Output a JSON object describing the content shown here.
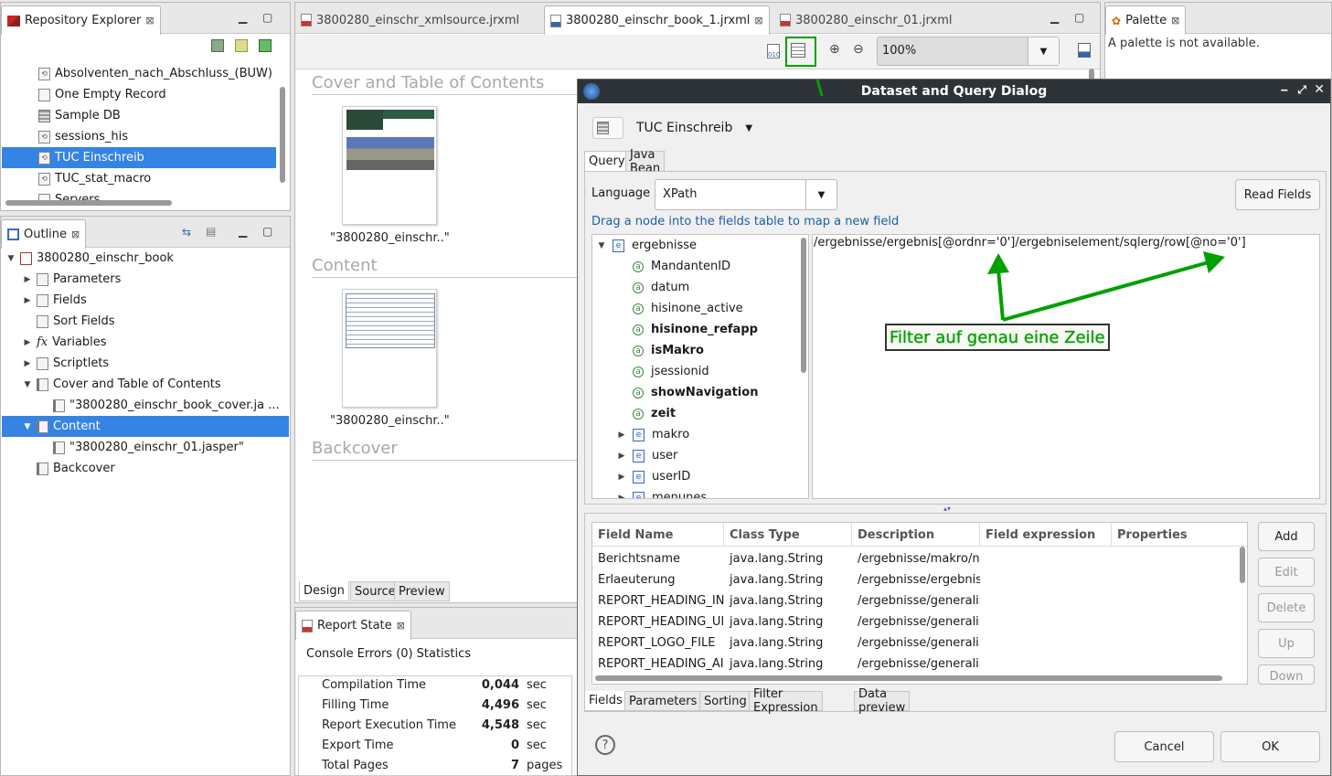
{
  "repo": {
    "tab_label": "Repository Explorer",
    "items": [
      {
        "label": "Absolventen_nach_Abschluss_(BUW)",
        "icon": "datasource-icon"
      },
      {
        "label": "One Empty Record",
        "icon": "empty-record-icon"
      },
      {
        "label": "Sample DB",
        "icon": "database-icon"
      },
      {
        "label": "sessions_his",
        "icon": "datasource-icon"
      },
      {
        "label": "TUC Einschreib",
        "icon": "datasource-icon",
        "selected": true
      },
      {
        "label": "TUC_stat_macro",
        "icon": "datasource-icon"
      },
      {
        "label": "Servers",
        "icon": "folder-icon"
      }
    ]
  },
  "outline": {
    "tab_label": "Outline",
    "items": [
      {
        "label": "3800280_einschr_book",
        "level": 0,
        "twisty": "open"
      },
      {
        "label": "Parameters",
        "level": 1,
        "twisty": "closed"
      },
      {
        "label": "Fields",
        "level": 1,
        "twisty": "closed"
      },
      {
        "label": "Sort Fields",
        "level": 1,
        "twisty": ""
      },
      {
        "label": "Variables",
        "level": 1,
        "twisty": "closed",
        "prefix": "fx"
      },
      {
        "label": "Scriptlets",
        "level": 1,
        "twisty": "closed"
      },
      {
        "label": "Cover and Table of Contents",
        "level": 1,
        "twisty": "open"
      },
      {
        "label": "\"3800280_einschr_book_cover.ja ...",
        "level": 2,
        "twisty": ""
      },
      {
        "label": "Content",
        "level": 1,
        "twisty": "open",
        "selected": true
      },
      {
        "label": "\"3800280_einschr_01.jasper\"",
        "level": 2,
        "twisty": ""
      },
      {
        "label": "Backcover",
        "level": 1,
        "twisty": ""
      }
    ]
  },
  "editor": {
    "tabs": [
      {
        "label": "3800280_einschr_xmlsource.jrxml",
        "active": false
      },
      {
        "label": "3800280_einschr_book_1.jrxml",
        "active": true
      },
      {
        "label": "3800280_einschr_01.jrxml",
        "active": false
      }
    ],
    "zoom": "100%",
    "sections": [
      {
        "title": "Cover and Table of Contents",
        "thumb_label": "\"3800280_einschr..\""
      },
      {
        "title": "Content",
        "thumb_label": "\"3800280_einschr..\""
      },
      {
        "title": "Backcover"
      }
    ],
    "bottom_tabs": [
      "Design",
      "Source",
      "Preview"
    ]
  },
  "palette": {
    "tab_label": "Palette",
    "message": "A palette is not available."
  },
  "report_state": {
    "tab_label": "Report State",
    "subtabs": [
      "Console",
      "Errors (0)",
      "Statistics"
    ],
    "rows": [
      {
        "label": "Compilation Time",
        "value": "0,044",
        "unit": "sec"
      },
      {
        "label": "Filling Time",
        "value": "4,496",
        "unit": "sec"
      },
      {
        "label": "Report Execution Time",
        "value": "4,548",
        "unit": "sec"
      },
      {
        "label": "Export Time",
        "value": "0",
        "unit": "sec"
      },
      {
        "label": "Total Pages",
        "value": "7",
        "unit": "pages"
      }
    ]
  },
  "dialog": {
    "title": "Dataset and Query Dialog",
    "datasource": "TUC Einschreib",
    "tabs": [
      "Query",
      "Java Bean"
    ],
    "language_label": "Language",
    "language_value": "XPath",
    "read_fields": "Read Fields",
    "hint": "Drag a node into the fields table to map a new field",
    "tree": [
      {
        "label": "ergebnisse",
        "kind": "element",
        "twisty": "open",
        "level": 0
      },
      {
        "label": "MandantenID",
        "kind": "attr",
        "level": 1
      },
      {
        "label": "datum",
        "kind": "attr",
        "level": 1
      },
      {
        "label": "hisinone_active",
        "kind": "attr",
        "level": 1
      },
      {
        "label": "hisinone_refapp",
        "kind": "attr",
        "level": 1,
        "bold": true
      },
      {
        "label": "isMakro",
        "kind": "attr",
        "level": 1,
        "bold": true
      },
      {
        "label": "jsessionid",
        "kind": "attr",
        "level": 1
      },
      {
        "label": "showNavigation",
        "kind": "attr",
        "level": 1,
        "bold": true
      },
      {
        "label": "zeit",
        "kind": "attr",
        "level": 1,
        "bold": true
      },
      {
        "label": "makro",
        "kind": "element",
        "twisty": "closed",
        "level": 1
      },
      {
        "label": "user",
        "kind": "element",
        "twisty": "closed",
        "level": 1
      },
      {
        "label": "userID",
        "kind": "element",
        "twisty": "closed",
        "level": 1
      },
      {
        "label": "menunes",
        "kind": "element",
        "twisty": "closed",
        "level": 1
      }
    ],
    "query": "/ergebnisse/ergebnis[@ordnr='0']/ergebniselement/sqlerg/row[@no='0']",
    "annotation": "Filter auf genau eine Zeile",
    "columns": [
      "Field Name",
      "Class Type",
      "Description",
      "Field expression",
      "Properties"
    ],
    "fields": [
      [
        "Berichtsname",
        "java.lang.String",
        "/ergebnisse/makro/na",
        "",
        ""
      ],
      [
        "Erlaeuterung",
        "java.lang.String",
        "/ergebnisse/ergebnis",
        "",
        ""
      ],
      [
        "REPORT_HEADING_IN",
        "java.lang.String",
        "/ergebnisse/generalir",
        "",
        ""
      ],
      [
        "REPORT_HEADING_UI",
        "java.lang.String",
        "/ergebnisse/generalir",
        "",
        ""
      ],
      [
        "REPORT_LOGO_FILE",
        "java.lang.String",
        "/ergebnisse/generalir",
        "",
        ""
      ],
      [
        "REPORT_HEADING_AI",
        "java.lang.String",
        "/ergebnisse/generalir",
        "",
        ""
      ]
    ],
    "side_buttons": [
      {
        "label": "Add",
        "enabled": true
      },
      {
        "label": "Edit",
        "enabled": false
      },
      {
        "label": "Delete",
        "enabled": false
      },
      {
        "label": "Up",
        "enabled": false
      },
      {
        "label": "Down",
        "enabled": false
      }
    ],
    "bottom_tabs": [
      "Fields",
      "Parameters",
      "Sorting",
      "Filter Expression",
      "Data preview"
    ],
    "cancel": "Cancel",
    "ok": "OK",
    "accent": "#00a000"
  }
}
